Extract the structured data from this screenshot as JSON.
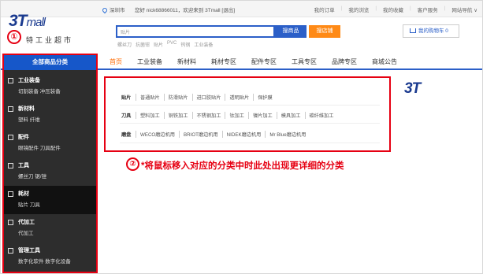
{
  "topbar": {
    "location": "深圳市",
    "welcome": "您好  nick68866011，欢迎来到 3Tmall [退出]",
    "links": [
      "我的订单",
      "我的浏览",
      "我的收藏",
      "客户服务",
      "网站导航 ∨"
    ]
  },
  "logo": {
    "mark": "3T",
    "mall": "mall",
    "subtitle": "特工业超市"
  },
  "search": {
    "placeholder": "贴片",
    "search_button": "搜商品",
    "shop_button": "搜店铺",
    "hot_words": [
      "螺丝刀",
      "抗菌钳",
      "贴片",
      "PVC",
      "钨钢",
      "工业装备"
    ]
  },
  "cart": {
    "label": "我的购物车 0"
  },
  "nav": {
    "all_categories": "全部商品分类",
    "items": [
      "首页",
      "工业装备",
      "新材料",
      "耗材专区",
      "配件专区",
      "工具专区",
      "品牌专区",
      "商城公告"
    ]
  },
  "sidebar": {
    "categories": [
      {
        "title": "工业装备",
        "sub": "切割装备  冲压装备"
      },
      {
        "title": "新材料",
        "sub": "塑料  纤维"
      },
      {
        "title": "配件",
        "sub": "眼镜配件  刀具配件"
      },
      {
        "title": "工具",
        "sub": "螺丝刀  锯/锉"
      },
      {
        "title": "耗材",
        "sub": "贴片  刀具"
      },
      {
        "title": "代加工",
        "sub": "代加工"
      },
      {
        "title": "管理工具",
        "sub": "数字化软件  数字化设备"
      }
    ]
  },
  "flyout": {
    "rows": [
      {
        "label": "贴片",
        "items": [
          "普通贴片",
          "防滑贴片",
          "进口胶贴片",
          "透明贴片",
          "保护膜"
        ]
      },
      {
        "label": "刀具",
        "items": [
          "塑料加工",
          "铜铁加工",
          "不锈钢加工",
          "钛加工",
          "镍片加工",
          "模具加工",
          "碳纤维加工"
        ]
      },
      {
        "label": "磨盘",
        "items": [
          "WECO磨边机用",
          "BRIOT磨边机用",
          "NIDEK磨边机用",
          "Mr Blue磨边机用"
        ]
      }
    ]
  },
  "ad_mark": "3T",
  "annotations": {
    "step1": "①",
    "step2": "②",
    "tip": "*将鼠标移入对应的分类中时此处出现更详细的分类"
  },
  "colors": {
    "brand_blue": "#1657c9",
    "highlight_red": "#e60012",
    "orange": "#ff8a16",
    "active_nav": "#ff6a00"
  }
}
